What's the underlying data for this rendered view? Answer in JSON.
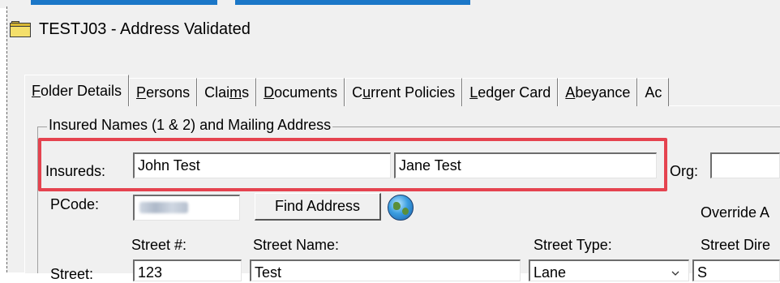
{
  "window": {
    "title": "TESTJ03 - Address Validated"
  },
  "tabs": [
    {
      "prefix": "",
      "u": "F",
      "rest": "older Details",
      "active": true
    },
    {
      "prefix": "",
      "u": "P",
      "rest": "ersons",
      "active": false
    },
    {
      "prefix": "Clai",
      "u": "m",
      "rest": "s",
      "active": false
    },
    {
      "prefix": "",
      "u": "D",
      "rest": "ocuments",
      "active": false
    },
    {
      "prefix": "C",
      "u": "u",
      "rest": "rrent Policies",
      "active": false
    },
    {
      "prefix": "",
      "u": "L",
      "rest": "edger Card",
      "active": false
    },
    {
      "prefix": "",
      "u": "A",
      "rest": "beyance",
      "active": false
    },
    {
      "prefix": "Ac",
      "u": "",
      "rest": "",
      "active": false
    }
  ],
  "group": {
    "legend": "Insured Names (1 & 2) and Mailing Address"
  },
  "insureds": {
    "label": "Insureds:",
    "name1": "John Test",
    "name2": "Jane Test"
  },
  "org": {
    "label": "Org:",
    "value": ""
  },
  "pcode": {
    "label": "PCode:"
  },
  "find_address": {
    "label": "Find Address"
  },
  "override": {
    "label": "Override A"
  },
  "street": {
    "label": "Street:",
    "number_header": "Street #:",
    "name_header": "Street Name:",
    "type_header": "Street Type:",
    "dir_header": "Street Dire",
    "number": "123",
    "name": "Test",
    "type": "Lane",
    "dir": "S"
  },
  "colors": {
    "highlight": "#e5434f",
    "accent": "#1b77c8"
  }
}
